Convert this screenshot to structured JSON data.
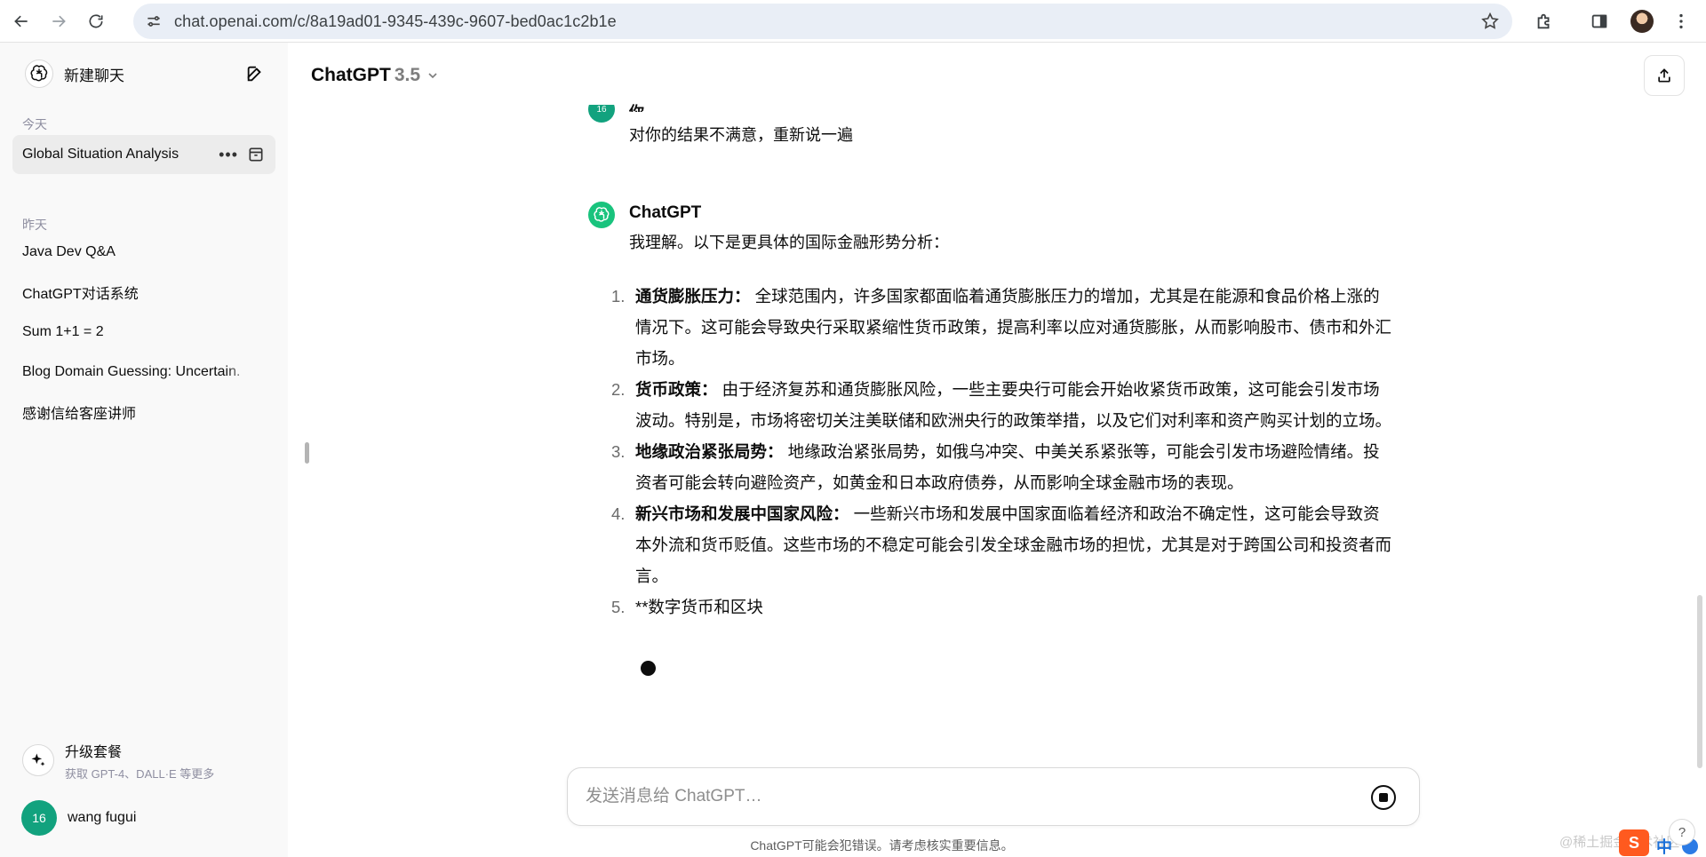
{
  "browser": {
    "url": "chat.openai.com/c/8a19ad01-9345-439c-9607-bed0ac1c2b1e"
  },
  "sidebar": {
    "new_chat_label": "新建聊天",
    "sections": [
      {
        "label": "今天",
        "items": [
          {
            "label": "Global Situation Analysis",
            "active": true
          }
        ]
      },
      {
        "label": "昨天",
        "items": [
          {
            "label": "Java Dev Q&A"
          },
          {
            "label": "ChatGPT对话系统"
          },
          {
            "label": "Sum 1+1 = 2"
          },
          {
            "label": "Blog Domain Guessing: Uncertain."
          },
          {
            "label": "感谢信给客座讲师"
          }
        ]
      }
    ],
    "upgrade": {
      "title": "升级套餐",
      "subtitle": "获取 GPT-4、DALL·E 等更多"
    },
    "user": {
      "name": "wang fugui",
      "avatar_text": "16"
    }
  },
  "header": {
    "model_name": "ChatGPT",
    "model_version": "3.5"
  },
  "conversation": {
    "user_message": {
      "avatar_text": "16",
      "author": "你",
      "text": "对你的结果不满意，重新说一遍"
    },
    "assistant_message": {
      "author": "ChatGPT",
      "intro": "我理解。以下是更具体的国际金融形势分析：",
      "items": [
        {
          "num": "1.",
          "title": "通货膨胀压力：",
          "text": " 全球范围内，许多国家都面临着通货膨胀压力的增加，尤其是在能源和食品价格上涨的情况下。这可能会导致央行采取紧缩性货币政策，提高利率以应对通货膨胀，从而影响股市、债市和外汇市场。"
        },
        {
          "num": "2.",
          "title": "货币政策：",
          "text": " 由于经济复苏和通货膨胀风险，一些主要央行可能会开始收紧货币政策，这可能会引发市场波动。特别是，市场将密切关注美联储和欧洲央行的政策举措，以及它们对利率和资产购买计划的立场。"
        },
        {
          "num": "3.",
          "title": "地缘政治紧张局势：",
          "text": " 地缘政治紧张局势，如俄乌冲突、中美关系紧张等，可能会引发市场避险情绪。投资者可能会转向避险资产，如黄金和日本政府债券，从而影响全球金融市场的表现。"
        },
        {
          "num": "4.",
          "title": "新兴市场和发展中国家风险：",
          "text": " 一些新兴市场和发展中国家面临着经济和政治不确定性，这可能会导致资本外流和货币贬值。这些市场的不稳定可能会引发全球金融市场的担忧，尤其是对于跨国公司和投资者而言。"
        },
        {
          "num": "5.",
          "title": "",
          "text": "**数字货币和区块"
        }
      ]
    }
  },
  "composer": {
    "placeholder": "发送消息给 ChatGPT…",
    "value": "",
    "disclaimer": "ChatGPT可能会犯错误。请考虑核实重要信息。"
  },
  "watermark": {
    "text": "@稀土掘金技术社区",
    "badge": "S",
    "ime": "中"
  },
  "help": {
    "label": "?"
  },
  "colors": {
    "accent_green": "#19c37d",
    "user_avatar": "#12a27e",
    "sidebar_bg": "#f9f9f9",
    "active_item_bg": "#ececec"
  },
  "icons": [
    "back-arrow-icon",
    "forward-arrow-icon",
    "reload-icon",
    "site-settings-icon",
    "star-icon",
    "extensions-icon",
    "sidebar-panel-icon",
    "kebab-menu-icon",
    "openai-logo-icon",
    "edit-icon",
    "more-dots-icon",
    "archive-icon",
    "sparkle-icon",
    "chevron-down-icon",
    "share-icon",
    "stop-icon"
  ]
}
